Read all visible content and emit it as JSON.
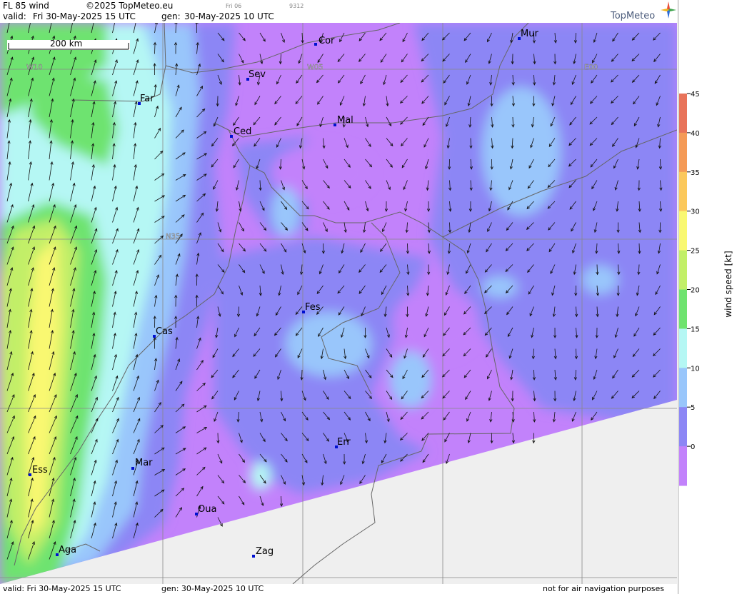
{
  "header": {
    "title": "FL 85 wind",
    "copyright": "©2025 TopMeteo.eu",
    "valid_label": "valid:",
    "valid_time": "Fri  30-May-2025  15 UTC",
    "gen_label": "gen:",
    "gen_time": "30-May-2025 10 UTC",
    "small_day": "Fri 06",
    "small_code": "9312",
    "logo": "TopMeteo"
  },
  "footer": {
    "valid": "valid:  Fri  30-May-2025  15 UTC",
    "gen": "gen: 30-May-2025 10 UTC",
    "disclaimer": "not for air navigation purposes"
  },
  "scale_bar": {
    "label": "200 km"
  },
  "grid_labels": {
    "w10": "W10",
    "w05": "W05",
    "e00": "E00",
    "n35": "N35"
  },
  "cities": [
    {
      "name": "Cor"
    },
    {
      "name": "Mur"
    },
    {
      "name": "Sev"
    },
    {
      "name": "Far"
    },
    {
      "name": "Ced"
    },
    {
      "name": "Mal"
    },
    {
      "name": "Fes"
    },
    {
      "name": "Cas"
    },
    {
      "name": "Err"
    },
    {
      "name": "Mar"
    },
    {
      "name": "Ess"
    },
    {
      "name": "Oua"
    },
    {
      "name": "Aga"
    },
    {
      "name": "Zag"
    }
  ],
  "legend": {
    "title": "wind  speed  [kt]",
    "ticks": [
      "45",
      "40",
      "35",
      "30",
      "25",
      "20",
      "15",
      "10",
      "5",
      "0"
    ],
    "colors": [
      "#e8735a",
      "#f49a57",
      "#fbc85c",
      "#f9f871",
      "#c2ef68",
      "#6ee36f",
      "#b5f7f4",
      "#99c6fb",
      "#8c86f5",
      "#c282fb"
    ]
  },
  "map_colors": {
    "calm": "#c282fb",
    "light": "#8c86f5",
    "moderate": "#99c6fb",
    "fresh": "#b5f7f4",
    "strong": "#6ee36f",
    "stronger": "#c2ef68",
    "high": "#f9f871",
    "nodata": "#efefef"
  }
}
